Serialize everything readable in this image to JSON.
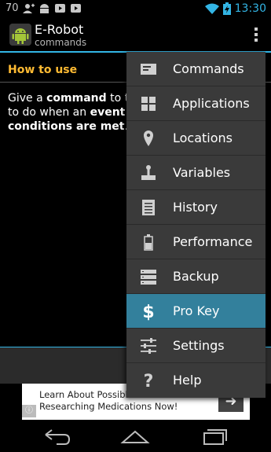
{
  "statusbar": {
    "left_text": "70",
    "icons_left": [
      "person-add-icon",
      "android-icon",
      "play-store-icon",
      "play-store-icon"
    ],
    "time": "13:30"
  },
  "actionbar": {
    "title": "E-Robot",
    "subtitle": "commands"
  },
  "content": {
    "section_title": "How to use",
    "body": {
      "p1": "Give a ",
      "p2": "command",
      "p3": " to the",
      "p4": "to do when an ",
      "p5": "event hap",
      "p6": "conditions are met",
      "p7": "."
    }
  },
  "ad": {
    "line1": "Learn About Possible",
    "line2": "Researching Medications Now!"
  },
  "menu": {
    "items": [
      {
        "label": "Commands",
        "icon": "commands-icon"
      },
      {
        "label": "Applications",
        "icon": "applications-icon"
      },
      {
        "label": "Locations",
        "icon": "location-pin-icon"
      },
      {
        "label": "Variables",
        "icon": "variables-icon"
      },
      {
        "label": "History",
        "icon": "history-icon"
      },
      {
        "label": "Performance",
        "icon": "battery-icon"
      },
      {
        "label": "Backup",
        "icon": "backup-icon"
      },
      {
        "label": "Pro Key",
        "icon": "dollar-icon"
      },
      {
        "label": "Settings",
        "icon": "settings-sliders-icon"
      },
      {
        "label": "Help",
        "icon": "help-icon"
      }
    ],
    "active_index": 7
  },
  "colors": {
    "accent": "#33b5e5",
    "section_title": "#ffbb33",
    "menu_bg": "#3a3a3a",
    "menu_active": "#33809c"
  }
}
